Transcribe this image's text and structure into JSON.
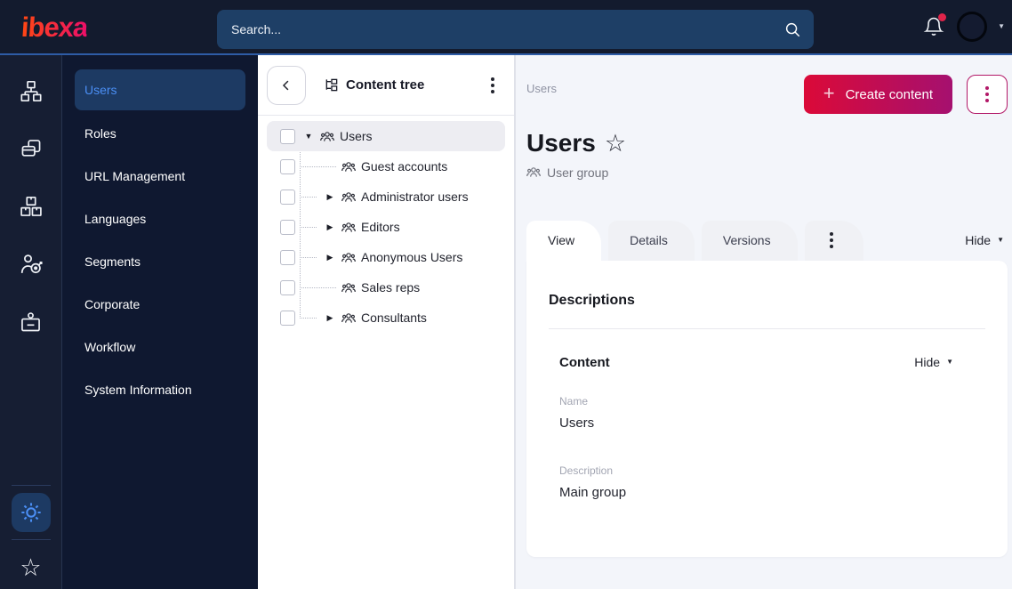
{
  "topbar": {
    "logo_text": "ibexa",
    "search_placeholder": "Search...",
    "has_notification_badge": true
  },
  "rail": {
    "items": [
      {
        "icon": "content-structure-icon"
      },
      {
        "icon": "pages-icon"
      },
      {
        "icon": "product-catalog-icon"
      },
      {
        "icon": "personalization-icon"
      },
      {
        "icon": "admin-badge-icon"
      }
    ],
    "footer": [
      {
        "icon": "settings-gear-icon",
        "active": true
      },
      {
        "icon": "bookmarks-star-icon"
      }
    ]
  },
  "sidebar": {
    "items": [
      {
        "label": "Users",
        "active": true
      },
      {
        "label": "Roles"
      },
      {
        "label": "URL Management"
      },
      {
        "label": "Languages"
      },
      {
        "label": "Segments"
      },
      {
        "label": "Corporate"
      },
      {
        "label": "Workflow"
      },
      {
        "label": "System Information"
      }
    ]
  },
  "content_tree": {
    "title": "Content tree",
    "items": [
      {
        "label": "Users",
        "state": "expanded",
        "selected": true
      },
      {
        "label": "Guest accounts",
        "state": "leaf"
      },
      {
        "label": "Administrator users",
        "state": "collapsed"
      },
      {
        "label": "Editors",
        "state": "collapsed"
      },
      {
        "label": "Anonymous Users",
        "state": "collapsed"
      },
      {
        "label": "Sales reps",
        "state": "leaf"
      },
      {
        "label": "Consultants",
        "state": "collapsed"
      }
    ]
  },
  "main": {
    "breadcrumb": "Users",
    "create_button_label": "Create content",
    "page_title": "Users",
    "content_type": "User group",
    "tabs": [
      {
        "label": "View",
        "active": true
      },
      {
        "label": "Details"
      },
      {
        "label": "Versions"
      }
    ],
    "hide_toggle_label": "Hide",
    "card": {
      "heading": "Descriptions",
      "section_title": "Content",
      "section_toggle_label": "Hide",
      "fields": [
        {
          "label": "Name",
          "value": "Users"
        },
        {
          "label": "Description",
          "value": "Main group"
        }
      ]
    }
  },
  "colors": {
    "topbar_bg": "#131b2e",
    "rail_bg": "#161e33",
    "sidebar_bg": "#0f1830",
    "accent_line": "#2e5ca6",
    "search_bg": "#1e3f66",
    "active_item_bg": "#1d3a63",
    "active_item_text": "#4b8ff5",
    "brand_gradient": [
      "#ff4713",
      "#ed0f69"
    ],
    "button_gradient": [
      "#db0a38",
      "#a5106f"
    ],
    "notification_badge": "#e0244a",
    "main_bg": "#f3f5fa",
    "selected_row_bg": "#ededf2"
  }
}
